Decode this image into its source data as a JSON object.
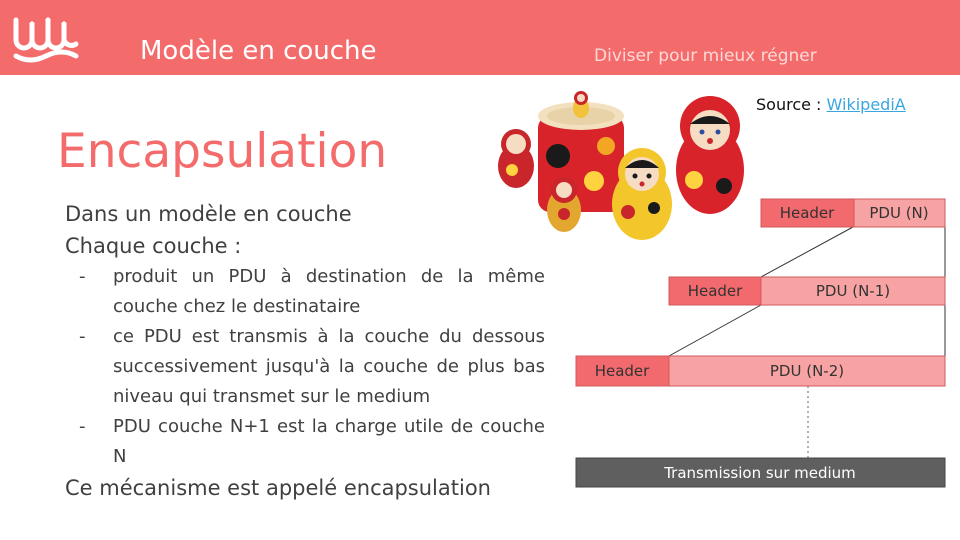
{
  "header": {
    "title": "Modèle en couche",
    "subtitle": "Diviser pour mieux régner",
    "accent": "#f46b6b"
  },
  "source": {
    "label": "Source :",
    "link_text": "WikipediA"
  },
  "page_title": "Encapsulation",
  "body": {
    "line1": "Dans un modèle en couche",
    "line2": "Chaque couche :",
    "bullets": [
      "produit un PDU à destination de la même couche chez le destinataire",
      "ce PDU est transmis à la couche du dessous successivement jusqu'à la couche de plus bas niveau qui transmet sur le medium",
      "PDU couche N+1 est la charge utile de couche N"
    ],
    "bullet_marker": "-",
    "conclusion": "Ce mécanisme est appelé encapsulation"
  },
  "diagram": {
    "layer1": {
      "header": "Header",
      "pdu": "PDU (N)"
    },
    "layer2": {
      "header": "Header",
      "pdu": "PDU (N-1)"
    },
    "layer3": {
      "header": "Header",
      "pdu": "PDU (N-2)"
    },
    "transmission": "Transmission sur medium",
    "colors": {
      "header": "#f26a6d",
      "pdu": "#f7a3a3",
      "transmission": "#5f5f5f"
    }
  }
}
